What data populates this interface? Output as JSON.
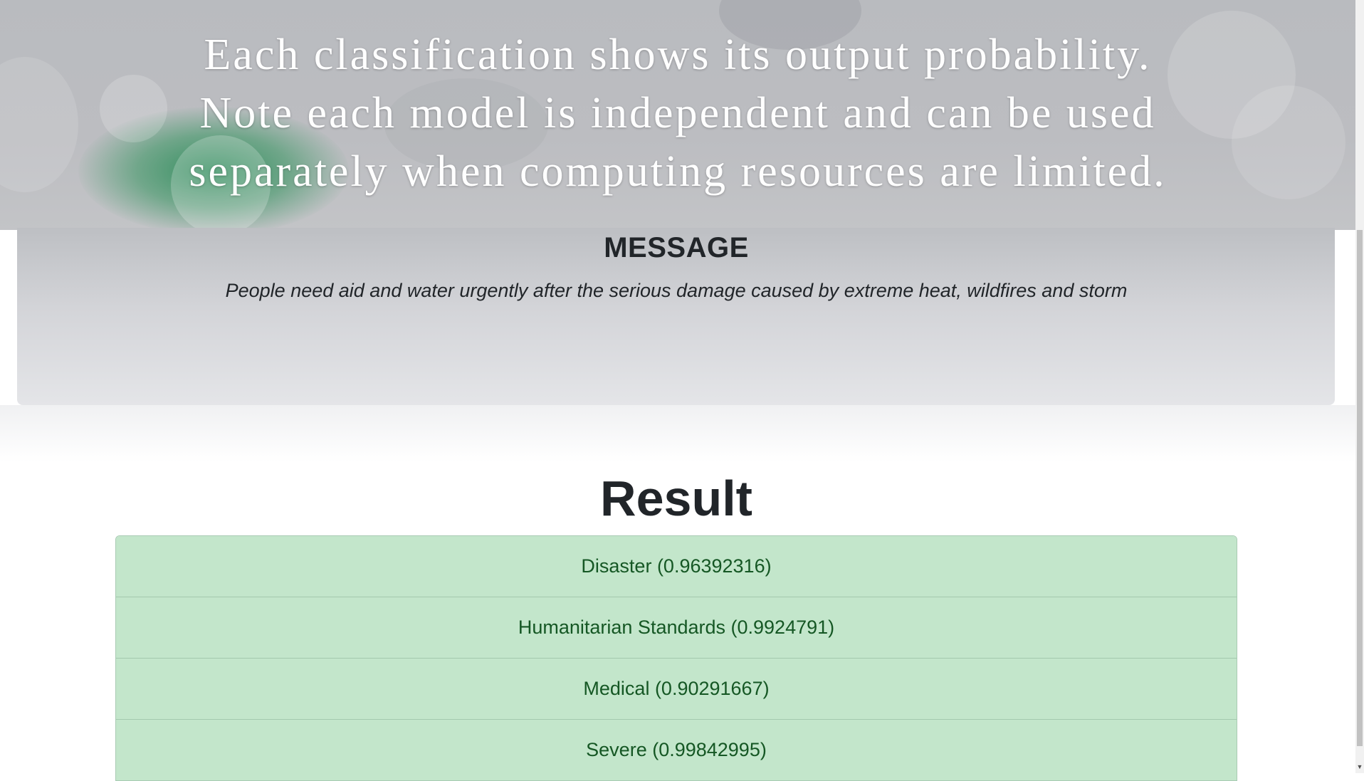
{
  "hero": {
    "line1": "Each classification shows its output probability.",
    "line2": "Note each model is independent and can be used",
    "line3": "separately when computing resources are limited."
  },
  "message": {
    "title": "MESSAGE",
    "text": "People need aid and water urgently after the serious damage caused by extreme heat, wildfires and storm"
  },
  "result": {
    "title": "Result",
    "items": [
      "Disaster (0.96392316)",
      "Humanitarian Standards (0.9924791)",
      "Medical (0.90291667)",
      "Severe (0.99842995)"
    ]
  },
  "colors": {
    "result_bg": "#c3e6cb",
    "result_text": "#155724",
    "accent_green": "#2c8c5a"
  },
  "icons": {
    "scroll_down": "scroll-down-arrow-icon"
  }
}
